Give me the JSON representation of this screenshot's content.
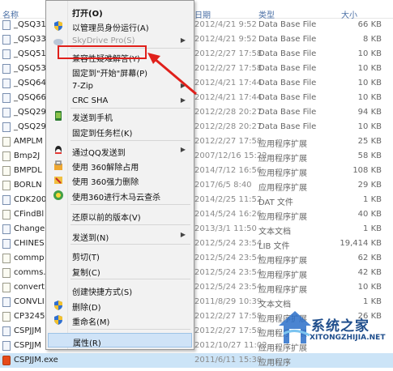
{
  "columns": {
    "name": "名称",
    "date": "日期",
    "type": "类型",
    "size": "大小"
  },
  "files": [
    {
      "name": "_QSQ31",
      "date": "2012/4/21 9:52",
      "type": "Data Base File",
      "size": "66 KB",
      "icon": "file-icon"
    },
    {
      "name": "_QSQ33",
      "date": "2012/4/21 9:52",
      "type": "Data Base File",
      "size": "8 KB",
      "icon": "file-icon"
    },
    {
      "name": "_QSQ51",
      "date": "2012/2/27 17:58",
      "type": "Data Base File",
      "size": "10 KB",
      "icon": "file-icon"
    },
    {
      "name": "_QSQ53",
      "date": "2012/2/27 17:58",
      "type": "Data Base File",
      "size": "10 KB",
      "icon": "file-icon"
    },
    {
      "name": "_QSQ64",
      "date": "2012/4/21 17:44",
      "type": "Data Base File",
      "size": "10 KB",
      "icon": "file-icon"
    },
    {
      "name": "_QSQ66",
      "date": "2012/4/21 17:44",
      "type": "Data Base File",
      "size": "10 KB",
      "icon": "file-icon"
    },
    {
      "name": "_QSQ29",
      "date": "2012/2/28 20:27",
      "type": "Data Base File",
      "size": "94 KB",
      "icon": "file-icon"
    },
    {
      "name": "_QSQ29",
      "date": "2012/2/28 20:27",
      "type": "Data Base File",
      "size": "10 KB",
      "icon": "file-icon"
    },
    {
      "name": "AMPLM",
      "date": "2012/2/27 17:58",
      "type": "应用程序扩展",
      "size": "25 KB",
      "icon": "dll-icon"
    },
    {
      "name": "Bmp2J",
      "date": "2007/12/16 15:22",
      "type": "应用程序扩展",
      "size": "58 KB",
      "icon": "dll-icon"
    },
    {
      "name": "BMPDL",
      "date": "2014/7/12 16:56",
      "type": "应用程序扩展",
      "size": "108 KB",
      "icon": "dll-icon"
    },
    {
      "name": "BORLN",
      "date": "2017/6/5 8:40",
      "type": "应用程序扩展",
      "size": "29 KB",
      "icon": "dll-icon"
    },
    {
      "name": "CDK200",
      "date": "2014/2/25 11:52",
      "type": "DAT 文件",
      "size": "1 KB",
      "icon": "file-icon"
    },
    {
      "name": "CFindBl",
      "date": "2014/5/24 16:26",
      "type": "应用程序扩展",
      "size": "40 KB",
      "icon": "dll-icon"
    },
    {
      "name": "Change",
      "date": "2013/3/1 11:50",
      "type": "文本文档",
      "size": "1 KB",
      "icon": "file-icon"
    },
    {
      "name": "CHINES",
      "date": "2012/5/24 23:54",
      "type": "LIB 文件",
      "size": "19,414 KB",
      "icon": "file-icon"
    },
    {
      "name": "commp",
      "date": "2012/5/24 23:54",
      "type": "应用程序扩展",
      "size": "62 KB",
      "icon": "dll-icon"
    },
    {
      "name": "comms.",
      "date": "2012/5/24 23:54",
      "type": "应用程序扩展",
      "size": "42 KB",
      "icon": "dll-icon"
    },
    {
      "name": "convert",
      "date": "2012/5/24 23:54",
      "type": "应用程序扩展",
      "size": "10 KB",
      "icon": "dll-icon"
    },
    {
      "name": "CONVLI",
      "date": "2011/8/29 10:39",
      "type": "文本文档",
      "size": "1 KB",
      "icon": "file-icon"
    },
    {
      "name": "CP3245",
      "date": "2012/2/27 17:58",
      "type": "应用程序扩展",
      "size": "26 KB",
      "icon": "dll-icon"
    },
    {
      "name": "CSPJJM",
      "date": "2012/2/27 17:58",
      "type": "应用程序扩展",
      "size": "",
      "icon": "file-icon"
    },
    {
      "name": "CSPJJM",
      "date": "2012/10/27 11:02",
      "type": "应用程序扩展",
      "size": "",
      "icon": "file-icon"
    },
    {
      "name": "CSPJJM.exe",
      "date": "2011/6/11 15:38",
      "type": "应用程序",
      "size": "",
      "icon": "exe-icon"
    }
  ],
  "menu": {
    "items": [
      {
        "label": "打开(O)",
        "bold": true,
        "icon": "",
        "arrow": false,
        "disabled": false
      },
      {
        "label": "以管理员身份运行(A)",
        "icon": "shield-icon",
        "arrow": false,
        "disabled": false
      },
      {
        "label": "SkyDrive Pro(S)",
        "icon": "skydrive-icon",
        "arrow": true,
        "disabled": true
      },
      {
        "label": "兼容性疑难解答(Y)",
        "icon": "",
        "arrow": false,
        "disabled": false
      },
      {
        "label": "固定到\"开始\"屏幕(P)",
        "icon": "",
        "arrow": false,
        "disabled": false
      },
      {
        "label": "7-Zip",
        "icon": "",
        "arrow": true,
        "disabled": false
      },
      {
        "label": "CRC SHA",
        "icon": "",
        "arrow": true,
        "disabled": false
      },
      {
        "label": "发送到手机",
        "icon": "phone-icon",
        "arrow": false,
        "disabled": false
      },
      {
        "label": "固定到任务栏(K)",
        "icon": "",
        "arrow": false,
        "disabled": false
      },
      {
        "label": "通过QQ发送到",
        "icon": "qq-icon",
        "arrow": true,
        "disabled": false
      },
      {
        "label": "使用 360解除占用",
        "icon": "unlock-360-icon",
        "arrow": false,
        "disabled": false
      },
      {
        "label": "使用 360强力删除",
        "icon": "delete-360-icon",
        "arrow": false,
        "disabled": false
      },
      {
        "label": "使用360进行木马云查杀",
        "icon": "scan-360-icon",
        "arrow": false,
        "disabled": false
      },
      {
        "label": "还原以前的版本(V)",
        "icon": "",
        "arrow": false,
        "disabled": false
      },
      {
        "label": "发送到(N)",
        "icon": "",
        "arrow": true,
        "disabled": false
      },
      {
        "label": "剪切(T)",
        "icon": "",
        "arrow": false,
        "disabled": false
      },
      {
        "label": "复制(C)",
        "icon": "",
        "arrow": false,
        "disabled": false
      },
      {
        "label": "创建快捷方式(S)",
        "icon": "",
        "arrow": false,
        "disabled": false
      },
      {
        "label": "删除(D)",
        "icon": "shield-icon",
        "arrow": false,
        "disabled": false
      },
      {
        "label": "重命名(M)",
        "icon": "shield-icon",
        "arrow": false,
        "disabled": false
      },
      {
        "label": "属性(R)",
        "icon": "",
        "arrow": false,
        "disabled": false
      }
    ],
    "highlighted": "兼容性疑难解答(Y)",
    "hovered": "属性(R)"
  },
  "watermark": {
    "text": "系统之家",
    "url": "XITONGZHIJIA.NET"
  },
  "colors": {
    "annotation": "#e0201b",
    "watermark": "#1f4e8c",
    "hover": "#cfe3f7"
  }
}
